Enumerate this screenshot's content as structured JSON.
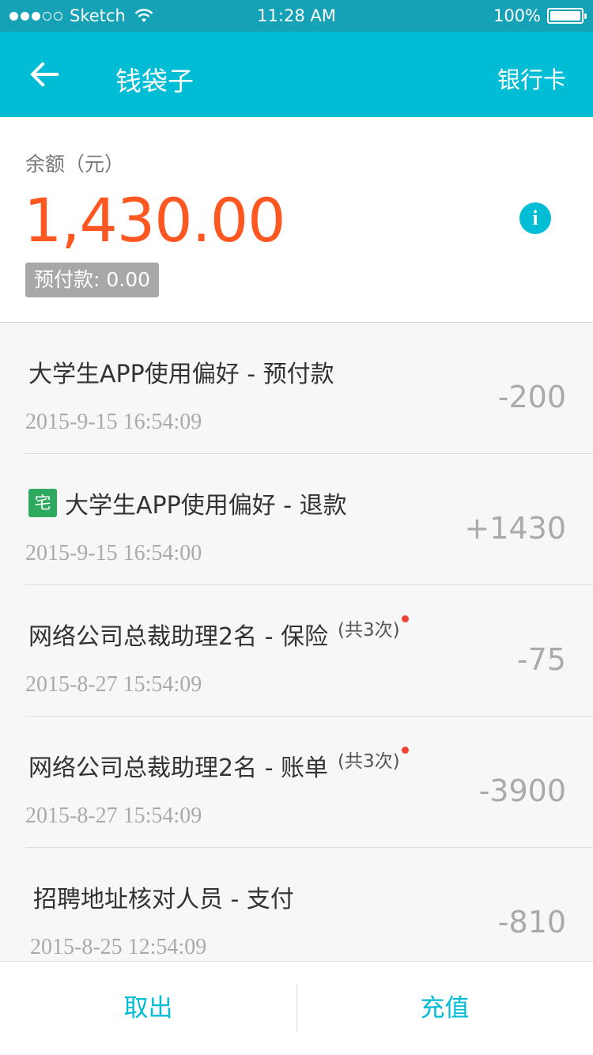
{
  "status_bar": {
    "carrier": "Sketch",
    "time": "11:28 AM",
    "battery": "100%"
  },
  "nav": {
    "title": "钱袋子",
    "right_link": "银行卡",
    "back_icon": "arrow-left-icon"
  },
  "balance": {
    "label": "余额（元）",
    "amount": "1,430.00",
    "prepaid": "预付款: 0.00",
    "info_icon": "info-icon"
  },
  "transactions": [
    {
      "title": "大学生APP使用偏好 - 预付款",
      "date": "2015-9-15  16:54:09",
      "amount": "-200"
    },
    {
      "tag": "宅",
      "title": "大学生APP使用偏好 - 退款",
      "date": "2015-9-15  16:54:00",
      "amount": "+1430"
    },
    {
      "title": "网络公司总裁助理2名 - 保险",
      "count": "(共3次)",
      "date": "2015-8-27  15:54:09",
      "amount": "-75"
    },
    {
      "title": "网络公司总裁助理2名 - 账单",
      "count": "(共3次)",
      "date": "2015-8-27  15:54:09",
      "amount": "-3900"
    },
    {
      "title": "招聘地址核对人员 - 支付",
      "date": "2015-8-25  12:54:09",
      "amount": "-810"
    }
  ],
  "bottom": {
    "withdraw": "取出",
    "recharge": "充值"
  },
  "colors": {
    "primary": "#00bcd4",
    "balance": "#ff5722",
    "tag_green": "#2eaa60",
    "badge_red": "#f44336"
  }
}
